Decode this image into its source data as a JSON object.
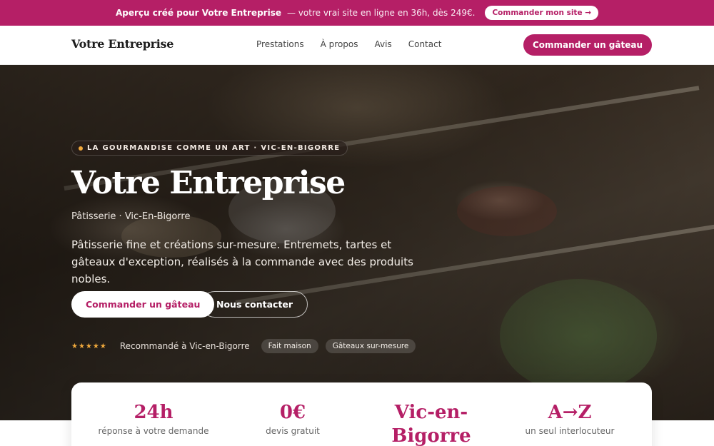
{
  "promo": {
    "lead": "Aperçu créé pour Votre Entreprise",
    "rest": "— votre vrai site en ligne en 36h, dès 249€.",
    "cta": "Commander mon site →"
  },
  "nav": {
    "brand": "Votre Entreprise",
    "items": [
      "Prestations",
      "À propos",
      "Avis",
      "Contact"
    ],
    "cta": "Commander un gâteau"
  },
  "hero": {
    "eyebrow": "LA GOURMANDISE COMME UN ART · VIC-EN-BIGORRE",
    "title": "Votre Entreprise",
    "subtitle": "Pâtisserie · Vic-En-Bigorre",
    "description": "Pâtisserie fine et créations sur-mesure. Entremets, tartes et gâteaux d'exception, réalisés à la commande avec des produits nobles.",
    "primary_cta": "Commander un gâteau",
    "secondary_cta": "Nous contacter",
    "stars": "★★★★★",
    "trust_text": "Recommandé à Vic-en-Bigorre",
    "pills": [
      "Fait maison",
      "Gâteaux sur-mesure"
    ]
  },
  "stats": [
    {
      "value": "24h",
      "label": "réponse à votre demande"
    },
    {
      "value": "0€",
      "label": "devis gratuit"
    },
    {
      "value": "Vic-en-Bigorre",
      "label": ""
    },
    {
      "value": "A→Z",
      "label": "un seul interlocuteur"
    }
  ],
  "colors": {
    "brand": "#b51f66",
    "star": "#f0a93c"
  }
}
